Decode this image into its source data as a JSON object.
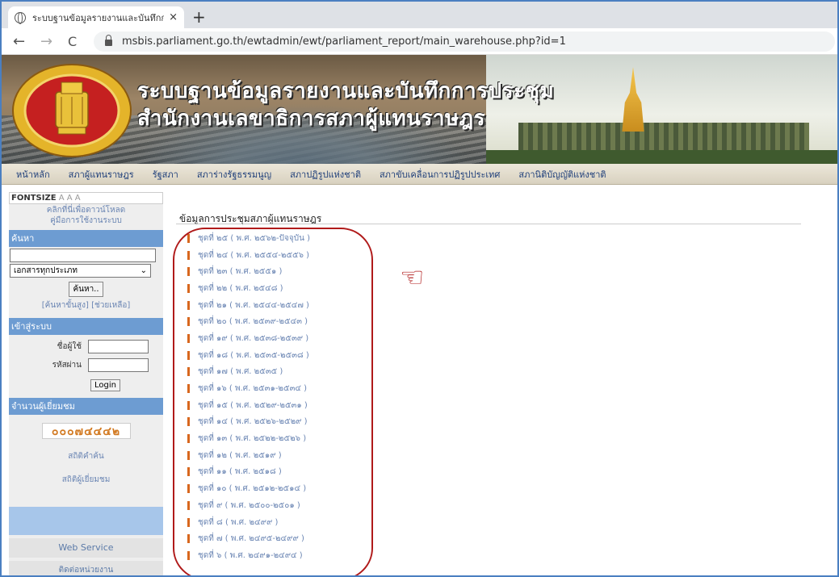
{
  "browser": {
    "tab_title": "ระบบฐานข้อมูลรายงานและบันทึกการประ",
    "tab_close": "×",
    "new_tab": "+",
    "back": "←",
    "forward": "→",
    "reload": "C",
    "url": "msbis.parliament.go.th/ewtadmin/ewt/parliament_report/main_warehouse.php?id=1"
  },
  "banner": {
    "title_line1": "ระบบฐานข้อมูลรายงานและบันทึกการประชุม",
    "title_line2": "สำนักงานเลขาธิการสภาผู้แทนราษฎร"
  },
  "menu": {
    "items": [
      "หน้าหลัก",
      "สภาผู้แทนราษฎร",
      "รัฐสภา",
      "สภาร่างรัฐธรรมนูญ",
      "สภาปฏิรูปแห่งชาติ",
      "สภาขับเคลื่อนการปฏิรูปประเทศ",
      "สภานิติบัญญัติแห่งชาติ"
    ]
  },
  "sidebar": {
    "fontsize_label": "FONTSIZE",
    "fontsize_options": "A A A",
    "download_line1": "คลิกที่นี่เพื่อดาวน์โหลด",
    "download_line2": "คู่มือการใช้งานระบบ",
    "search_header": "ค้นหา",
    "search_select": "เอกสารทุกประเภท",
    "search_button": "ค้นหา..",
    "advanced_search": "[ค้นหาขั้นสูง] [ช่วยเหลือ]",
    "login_header": "เข้าสู่ระบบ",
    "username_label": "ชื่อผู้ใช้",
    "password_label": "รหัสผ่าน",
    "login_button": "Login",
    "visitors_header": "จำนวนผู้เยี่ยมชม",
    "visitor_count": "๐๐๐๗๔๔๔๒",
    "stats_search": "สถิติคำค้น",
    "stats_visitors": "สถิติผู้เยี่ยมชม",
    "web_service": "Web Service",
    "contact": "ติดต่อหน่วยงาน"
  },
  "content": {
    "title": "ข้อมูลการประชุมสภาผู้แทนราษฎร",
    "annotation_icon": "☜",
    "items": [
      "ชุดที่ ๒๕ ( พ.ศ. ๒๕๖๒-ปัจจุบัน )",
      "ชุดที่ ๒๔ ( พ.ศ. ๒๕๕๔-๒๕๕๖ )",
      "ชุดที่ ๒๓ ( พ.ศ. ๒๕๕๑ )",
      "ชุดที่ ๒๒ ( พ.ศ. ๒๕๔๘ )",
      "ชุดที่ ๒๑ ( พ.ศ. ๒๕๔๔-๒๕๔๗ )",
      "ชุดที่ ๒๐ ( พ.ศ. ๒๕๓๙-๒๕๔๓ )",
      "ชุดที่ ๑๙ ( พ.ศ. ๒๕๓๘-๒๕๓๙ )",
      "ชุดที่ ๑๘ ( พ.ศ. ๒๕๓๕-๒๕๓๘ )",
      "ชุดที่ ๑๗ ( พ.ศ. ๒๕๓๕ )",
      "ชุดที่ ๑๖ ( พ.ศ. ๒๕๓๑-๒๕๓๔ )",
      "ชุดที่ ๑๕ ( พ.ศ. ๒๕๒๙-๒๕๓๑ )",
      "ชุดที่ ๑๔ ( พ.ศ. ๒๕๒๖-๒๕๒๙ )",
      "ชุดที่ ๑๓ ( พ.ศ. ๒๕๒๒-๒๕๒๖ )",
      "ชุดที่ ๑๒ ( พ.ศ. ๒๕๑๙ )",
      "ชุดที่ ๑๑ ( พ.ศ. ๒๕๑๘ )",
      "ชุดที่ ๑๐ ( พ.ศ. ๒๕๑๒-๒๕๑๔ )",
      "ชุดที่ ๙ ( พ.ศ. ๒๕๐๐-๒๕๐๑ )",
      "ชุดที่ ๘ ( พ.ศ. ๒๔๙๙ )",
      "ชุดที่ ๗ ( พ.ศ. ๒๔๙๕-๒๔๙๙ )",
      "ชุดที่ ๖ ( พ.ศ. ๒๔๙๑-๒๔๙๔ )"
    ]
  }
}
